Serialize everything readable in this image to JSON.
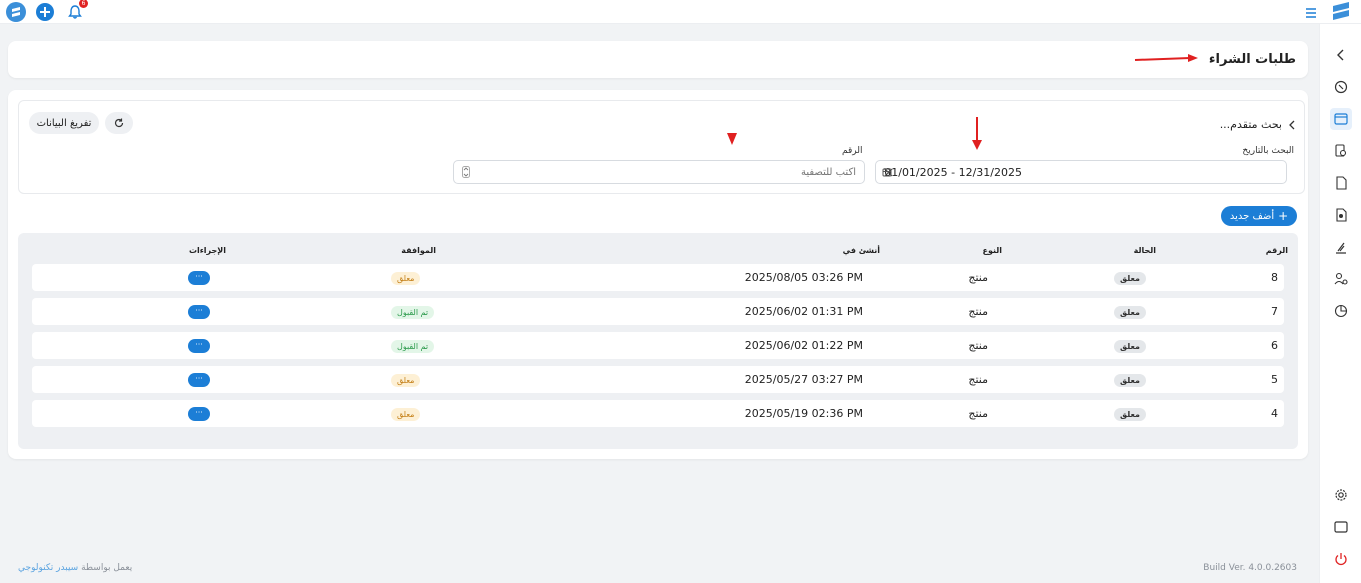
{
  "page": {
    "title": "طلبات الشراء"
  },
  "topbar": {
    "notification_count": "6"
  },
  "search": {
    "advanced_label": "بحث متقدم...",
    "date_label": "البحث بالتاريخ",
    "date_value": "01/01/2025 - 12/31/2025",
    "number_label": "الرقم",
    "number_placeholder": "أكتب للتصفية",
    "clear_button": "تفريغ البيانات"
  },
  "toolbar": {
    "add_new": "أضف جديد"
  },
  "table": {
    "headers": {
      "number": "الرقم",
      "status": "الحالة",
      "type": "النوع",
      "created": "أنشئ في",
      "approval": "الموافقة",
      "actions": "الإجراءات"
    },
    "rows": [
      {
        "number": "8",
        "status": "معلق",
        "type": "منتج",
        "created": "2025/08/05 03:26 PM",
        "approval": "معلق",
        "approval_state": "pending",
        "action": "···"
      },
      {
        "number": "7",
        "status": "معلق",
        "type": "منتج",
        "created": "2025/06/02 01:31 PM",
        "approval": "تم القبول",
        "approval_state": "accepted",
        "action": "···"
      },
      {
        "number": "6",
        "status": "معلق",
        "type": "منتج",
        "created": "2025/06/02 01:22 PM",
        "approval": "تم القبول",
        "approval_state": "accepted",
        "action": "···"
      },
      {
        "number": "5",
        "status": "معلق",
        "type": "منتج",
        "created": "2025/05/27 03:27 PM",
        "approval": "معلق",
        "approval_state": "pending",
        "action": "···"
      },
      {
        "number": "4",
        "status": "معلق",
        "type": "منتج",
        "created": "2025/05/19 02:36 PM",
        "approval": "معلق",
        "approval_state": "pending",
        "action": "···"
      }
    ]
  },
  "footer": {
    "build": "Build Ver. 4.0.0.2603",
    "powered_by": "يعمل بواسطة",
    "company": "سيبدر تكنولوجي"
  },
  "colors": {
    "accent": "#1c7ed6",
    "annotation": "#e02020"
  }
}
